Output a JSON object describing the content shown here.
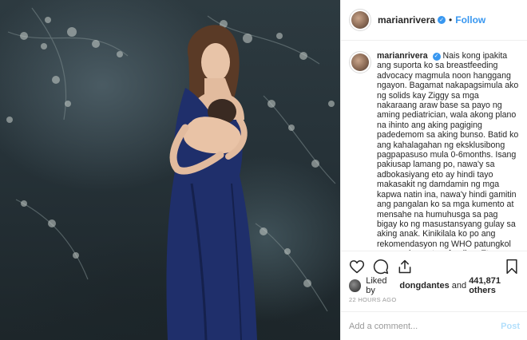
{
  "post": {
    "username": "marianrivera",
    "verified_glyph": "✓",
    "separator": "•",
    "follow_label": "Follow",
    "caption_username": "marianrivera",
    "caption_text": "Nais kong ipakita ang suporta ko sa breastfeeding advocacy magmula noon hanggang ngayon. Bagamat nakapagsimula ako ng solids kay Ziggy sa mga nakaraang araw base sa payo ng aming pediatrician, wala akong plano na ihinto ang aking pagiging padedemom sa aking bunso. Batid ko ang kahalagahan ng eksklusibong pagpapasuso mula 0-6months. Isang pakiusap lamang po, nawa'y sa adbokasiyang eto ay hindi tayo makasakit ng damdamin ng mga kapwa natin ina, nawa'y hindi gamitin ang pangalan ko sa mga kumento at mensahe na humuhusga sa pag bigay ko ng masustansyang gulay sa aking anak. Kinikilala ko po ang rekomendasyon ng WHO patungkol sa complementary feeding. Eto po ang"
  },
  "likes": {
    "prefix": "Liked by",
    "user": "dongdantes",
    "connector": "and",
    "count": "441,871 others"
  },
  "timestamp": "22 HOURS AGO",
  "comment": {
    "placeholder": "Add a comment...",
    "post_label": "Post"
  },
  "icons": {
    "like": "heart-icon",
    "comment": "comment-icon",
    "share": "share-icon",
    "save": "bookmark-icon",
    "verified": "verified-badge-icon"
  },
  "colors": {
    "link_blue": "#3897f0",
    "post_disabled": "#b2dffc",
    "text": "#262626",
    "muted": "#999999",
    "dress_navy": "#1f2f6b"
  }
}
